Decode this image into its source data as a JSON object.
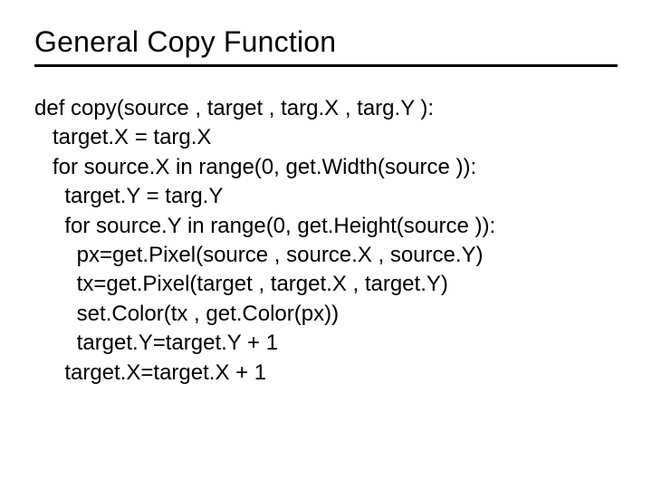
{
  "title": "General Copy Function",
  "code": {
    "l1": "def copy(source , target , targ.X , targ.Y ):",
    "l2": "   target.X = targ.X",
    "l3": "   for source.X in range(0, get.Width(source )):",
    "l4": "     target.Y = targ.Y",
    "l5": "     for source.Y in range(0, get.Height(source )):",
    "l6": "       px=get.Pixel(source , source.X , source.Y)",
    "l7": "       tx=get.Pixel(target , target.X , target.Y)",
    "l8": "       set.Color(tx , get.Color(px))",
    "l9": "       target.Y=target.Y + 1",
    "l10": "     target.X=target.X + 1"
  }
}
